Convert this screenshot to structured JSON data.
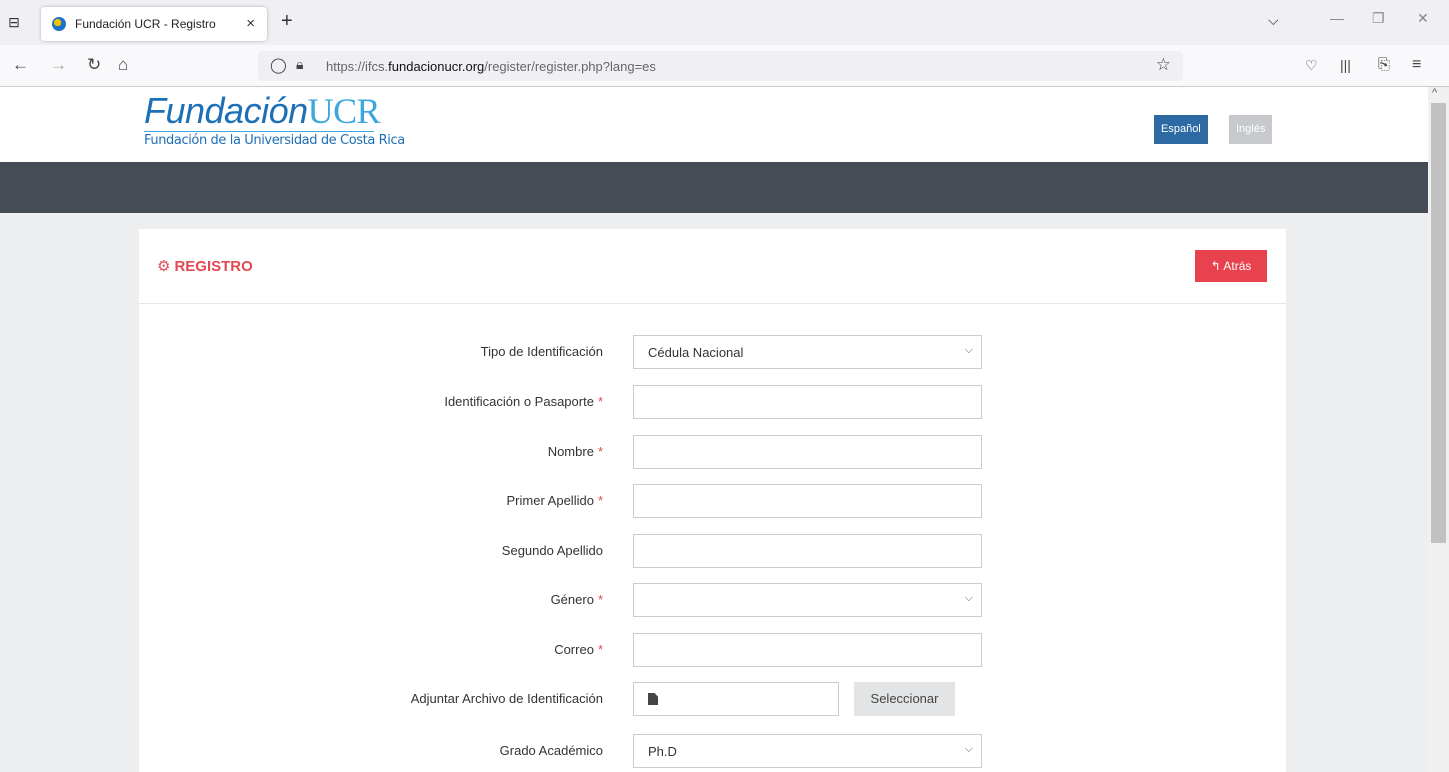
{
  "browser": {
    "tab_title": "Fundación UCR - Registro",
    "url_prefix": "https://ifcs.",
    "url_domain": "fundacionucr.org",
    "url_path": "/register/register.php?lang=es"
  },
  "header": {
    "logo_em": "Fundación",
    "logo_ucr": "UCR",
    "logo_sub": "Fundación de la Universidad de Costa Rica",
    "lang_es": "Español",
    "lang_en": "Inglés"
  },
  "card": {
    "title": "REGISTRO",
    "back_label": "Atrás"
  },
  "form": {
    "fields": [
      {
        "label": "Tipo de Identificación",
        "required": false,
        "type": "select",
        "value": "Cédula Nacional"
      },
      {
        "label": "Identificación o Pasaporte",
        "required": true,
        "type": "text",
        "value": ""
      },
      {
        "label": "Nombre",
        "required": true,
        "type": "text",
        "value": ""
      },
      {
        "label": "Primer Apellido",
        "required": true,
        "type": "text",
        "value": ""
      },
      {
        "label": "Segundo Apellido",
        "required": false,
        "type": "text",
        "value": ""
      },
      {
        "label": "Género",
        "required": true,
        "type": "select",
        "value": ""
      },
      {
        "label": "Correo",
        "required": true,
        "type": "text",
        "value": ""
      },
      {
        "label": "Adjuntar Archivo de Identificación",
        "required": false,
        "type": "file",
        "value": ""
      },
      {
        "label": "Grado Académico",
        "required": false,
        "type": "select",
        "value": "Ph.D"
      }
    ],
    "required_mark": "*",
    "select_file_label": "Seleccionar"
  },
  "colors": {
    "accent_red": "#e24a53",
    "brand_blue": "#1d6fb6",
    "dark_band": "#454c55"
  }
}
